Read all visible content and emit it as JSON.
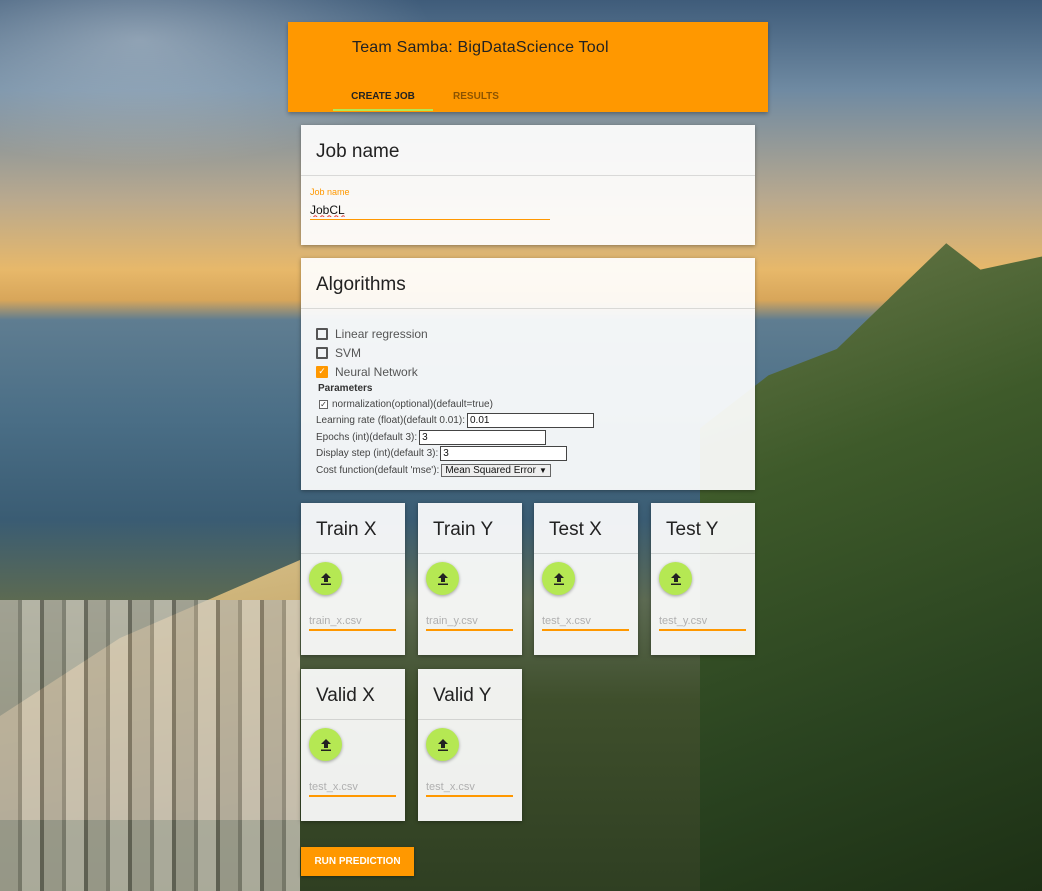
{
  "header": {
    "title": "Team Samba: BigDataScience Tool",
    "tabs": [
      {
        "label": "CREATE JOB",
        "active": true
      },
      {
        "label": "RESULTS",
        "active": false
      }
    ]
  },
  "job": {
    "title": "Job name",
    "field_label": "Job name",
    "value": "JobCL"
  },
  "algorithms": {
    "title": "Algorithms",
    "options": [
      {
        "label": "Linear regression",
        "checked": false
      },
      {
        "label": "SVM",
        "checked": false
      },
      {
        "label": "Neural Network",
        "checked": true
      }
    ],
    "params_heading": "Parameters",
    "normalization_label": "normalization(optional)(default=true)",
    "normalization_checked": true,
    "learning_rate_label": "Learning rate (float)(default 0.01):",
    "learning_rate_value": "0.01",
    "epochs_label": "Epochs (int)(default 3):",
    "epochs_value": "3",
    "display_step_label": "Display step (int)(default 3):",
    "display_step_value": "3",
    "cost_function_label": "Cost function(default 'mse'):",
    "cost_function_value": "Mean Squared Error"
  },
  "files": [
    {
      "title": "Train X",
      "placeholder": "train_x.csv"
    },
    {
      "title": "Train Y",
      "placeholder": "train_y.csv"
    },
    {
      "title": "Test X",
      "placeholder": "test_x.csv"
    },
    {
      "title": "Test Y",
      "placeholder": "test_y.csv"
    },
    {
      "title": "Valid X",
      "placeholder": "test_x.csv"
    },
    {
      "title": "Valid Y",
      "placeholder": "test_x.csv"
    }
  ],
  "run_button": "RUN PREDICTION",
  "colors": {
    "accent": "#ff9800",
    "upload": "#b5e853"
  }
}
